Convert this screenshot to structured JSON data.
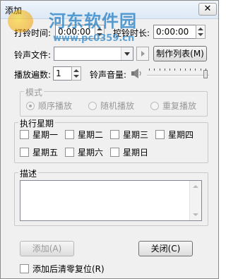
{
  "window": {
    "title": "添加",
    "close_glyph": "✕"
  },
  "watermark": {
    "site_name": "河东软件园",
    "url": "www.pc0359.cn"
  },
  "ring_time": {
    "label": "打铃时间:",
    "value": "0:00:00"
  },
  "control_duration": {
    "label": "控铃时长:",
    "value": "0:00:00"
  },
  "ring_file": {
    "label": "铃声文件:",
    "value": ""
  },
  "make_list_button": "制作列表(M)",
  "play_count": {
    "label": "播放遍数:",
    "value": "1"
  },
  "volume": {
    "label": "铃声音量:",
    "level_fraction": 0.98
  },
  "mode": {
    "label": "模式",
    "options": [
      {
        "label": "顺序播放",
        "selected": true
      },
      {
        "label": "随机播放",
        "selected": false
      },
      {
        "label": "重复播放",
        "selected": false
      }
    ]
  },
  "weekdays": {
    "label": "执行星期",
    "days": [
      "星期一",
      "星期二",
      "星期三",
      "星期四",
      "星期五",
      "星期六",
      "星期日"
    ]
  },
  "description": {
    "label": "描述",
    "value": ""
  },
  "add_button": "添加(A)",
  "close_button": "关闭(C)",
  "reset_after_add": {
    "label": "添加后清零复位(R)",
    "checked": false
  },
  "colors": {
    "watermark": "#2f86c8",
    "disabled_text": "#999999",
    "window_bg": "#f0f0f0"
  },
  "icons": [
    "close-icon",
    "speaker-icon",
    "dropdown-arrow-icon",
    "spin-up-icon",
    "spin-down-icon",
    "play-icon"
  ]
}
